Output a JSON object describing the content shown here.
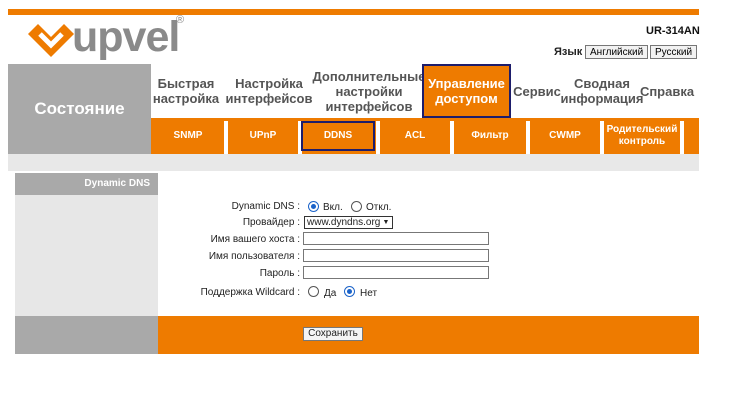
{
  "header": {
    "brand": "upvel",
    "registered": "®",
    "model": "UR-314AN",
    "lang_label": "Язык",
    "lang_english": "Английский",
    "lang_russian": "Русский",
    "accent_color": "#ee7b00"
  },
  "nav": {
    "state_label": "Состояние",
    "items": [
      {
        "label": "Быстрая настройка"
      },
      {
        "label": "Настройка интерфейсов"
      },
      {
        "label": "Дополнительные настройки интерфейсов"
      },
      {
        "label": "Управление доступом",
        "active": true
      },
      {
        "label": "Сервис"
      },
      {
        "label": "Сводная информация"
      },
      {
        "label": "Справка"
      }
    ],
    "subitems": [
      {
        "label": "SNMP"
      },
      {
        "label": "UPnP"
      },
      {
        "label": "DDNS",
        "active": true
      },
      {
        "label": "ACL"
      },
      {
        "label": "Фильтр"
      },
      {
        "label": "CWMP"
      },
      {
        "label": "Родительский контроль"
      }
    ]
  },
  "panel": {
    "section_title": "Dynamic DNS"
  },
  "form": {
    "ddns_label": "Dynamic DNS :",
    "ddns_on": "Вкл.",
    "ddns_off": "Откл.",
    "ddns_value": "on",
    "provider_label": "Провайдер :",
    "provider_value": "www.dyndns.org",
    "host_label": "Имя вашего хоста :",
    "user_label": "Имя пользователя :",
    "password_label": "Пароль :",
    "wildcard_label": "Поддержка Wildcard :",
    "wildcard_yes": "Да",
    "wildcard_no": "Нет",
    "wildcard_value": "no",
    "save_label": "Сохранить"
  }
}
